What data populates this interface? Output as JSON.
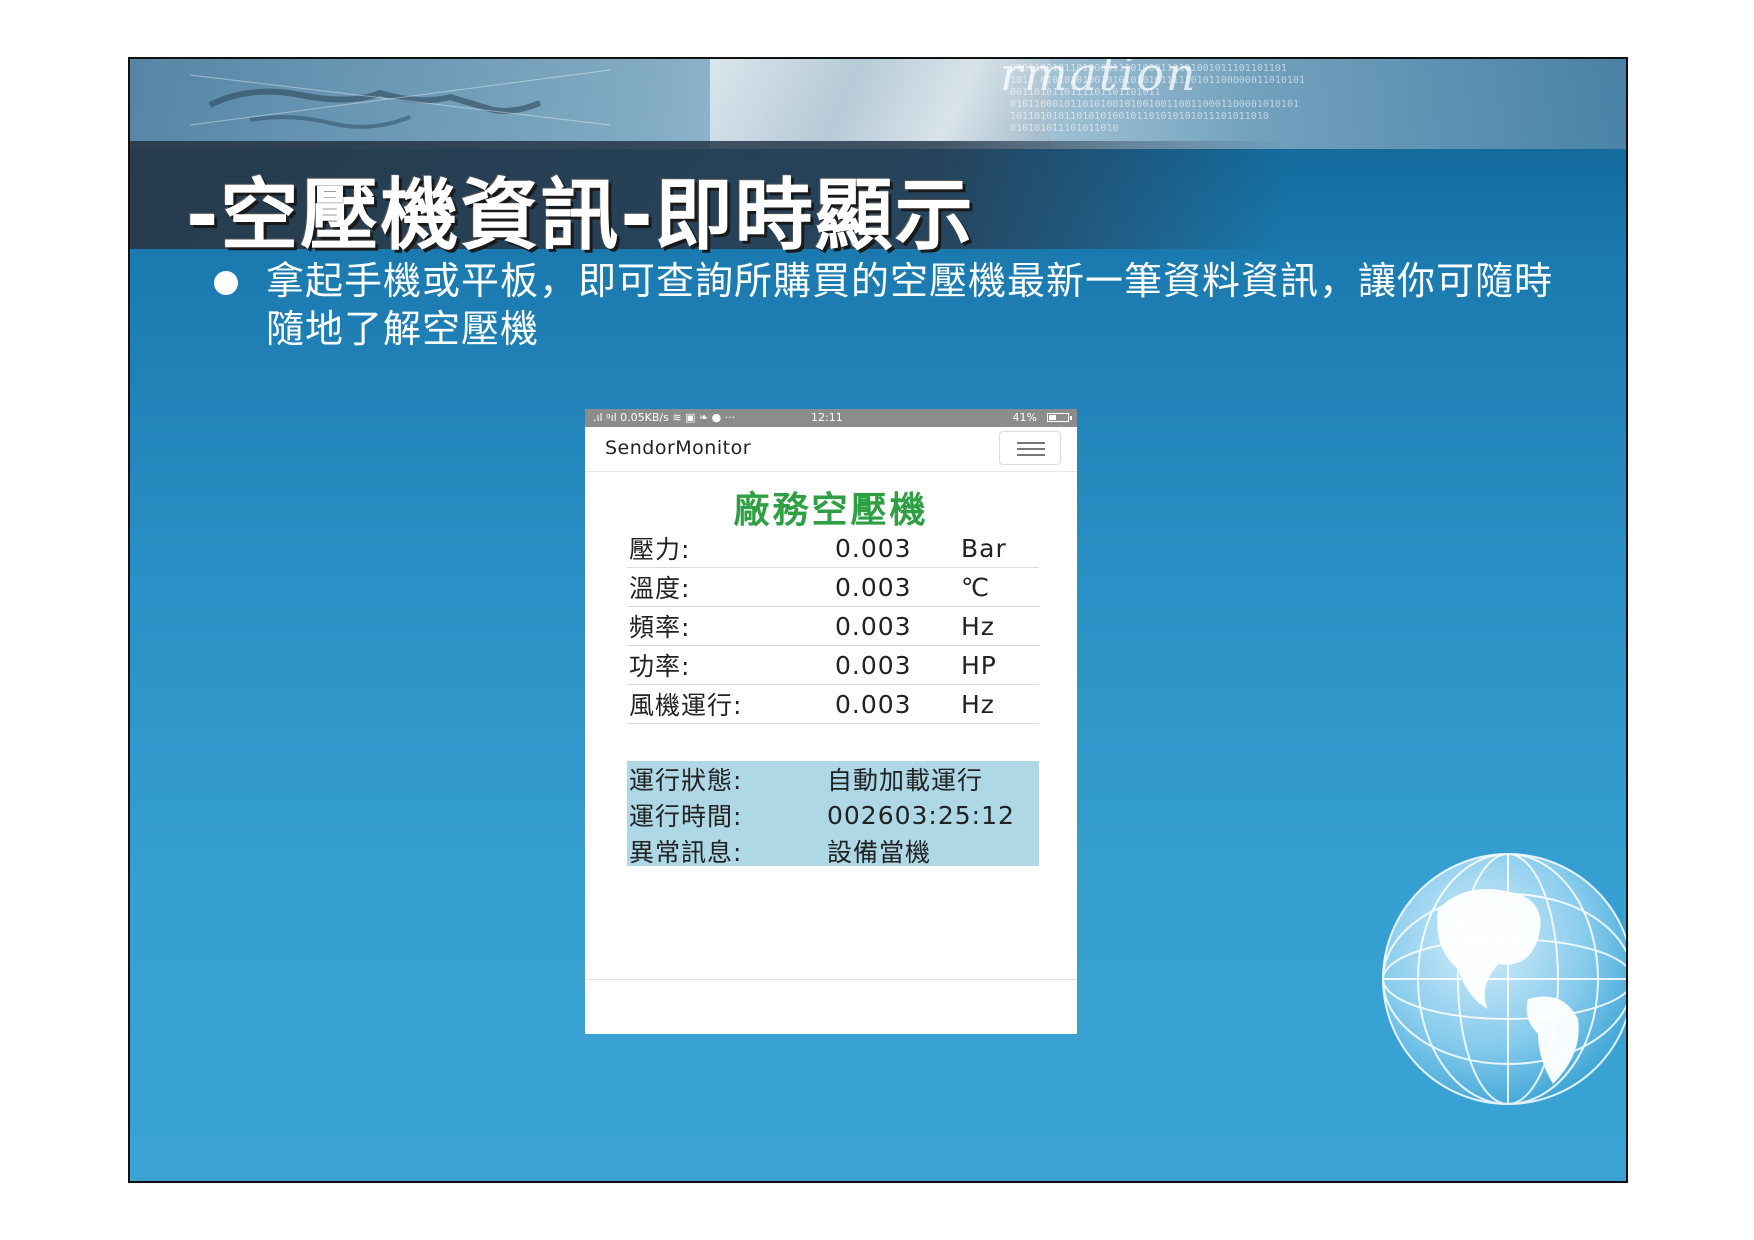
{
  "slide": {
    "banner_word": "rmation",
    "banner_binary": "0101100101101000011101000110101001011101101101\n1011 01010101001010101010111110101100000011010101\n0011010110111101101101011\n010110001011010100101001001100110001100001010101\n1011010101101010100101101010101011101011010\n010101011101011010",
    "title": "-空壓機資訊-即時顯示",
    "bullet": "拿起手機或平板，即可查詢所購買的空壓機最新一筆資料資訊，讓你可隨時隨地了解空壓機"
  },
  "phone": {
    "status_bar": {
      "left": ".ıl ᵍıl 0.05KB/s ≋ ▣ ❧ ● ···",
      "time": "12:11",
      "battery": "41%"
    },
    "navbar": {
      "brand": "SendorMonitor",
      "menu_icon": "hamburger-menu-icon"
    },
    "heading": "廠務空壓機",
    "readings": [
      {
        "label": "壓力:",
        "value": "0.003",
        "unit": "Bar"
      },
      {
        "label": "溫度:",
        "value": "0.003",
        "unit": "℃"
      },
      {
        "label": "頻率:",
        "value": "0.003",
        "unit": "Hz"
      },
      {
        "label": "功率:",
        "value": "0.003",
        "unit": "HP"
      },
      {
        "label": "風機運行:",
        "value": "0.003",
        "unit": "Hz"
      }
    ],
    "status": [
      {
        "label": "運行狀態:",
        "value": "自動加載運行"
      },
      {
        "label": "運行時間:",
        "value": "002603:25:12"
      },
      {
        "label": "異常訊息:",
        "value": "設備當機"
      }
    ]
  },
  "colors": {
    "heading_green": "#2ea043",
    "status_box_blue": "#aed8e6",
    "slide_blue": "#2a8fc4"
  }
}
